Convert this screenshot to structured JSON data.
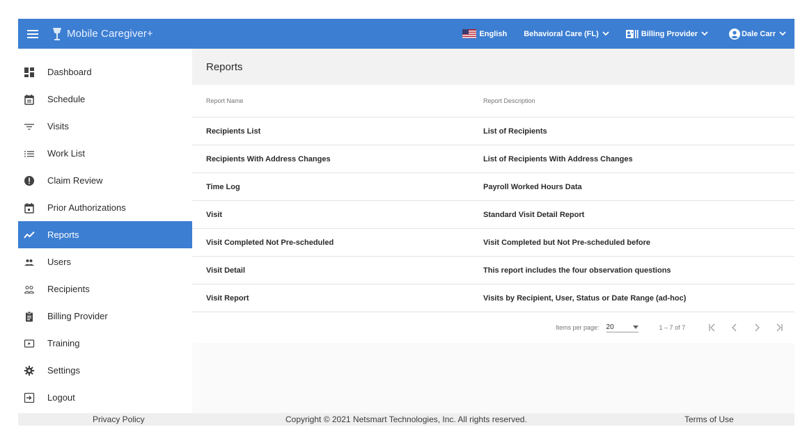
{
  "app": {
    "name": "Mobile Caregiver+",
    "brand_color": "#3c7ed2"
  },
  "topbar": {
    "language": "English",
    "organization": "Behavioral Care (FL)",
    "billing_provider": "Billing Provider",
    "user": "Dale Carr"
  },
  "sidebar": {
    "items": [
      {
        "label": "Dashboard",
        "icon": "dashboard-icon"
      },
      {
        "label": "Schedule",
        "icon": "calendar-icon"
      },
      {
        "label": "Visits",
        "icon": "filter-icon"
      },
      {
        "label": "Work List",
        "icon": "list-icon"
      },
      {
        "label": "Claim Review",
        "icon": "alert-circle-icon"
      },
      {
        "label": "Prior Authorizations",
        "icon": "calendar-event-icon"
      },
      {
        "label": "Reports",
        "icon": "trend-icon",
        "active": true
      },
      {
        "label": "Users",
        "icon": "users-icon"
      },
      {
        "label": "Recipients",
        "icon": "recipients-icon"
      },
      {
        "label": "Billing Provider",
        "icon": "clipboard-icon"
      },
      {
        "label": "Training",
        "icon": "training-icon"
      },
      {
        "label": "Settings",
        "icon": "gear-icon"
      },
      {
        "label": "Logout",
        "icon": "logout-icon"
      }
    ]
  },
  "main": {
    "title": "Reports",
    "columns": [
      "Report Name",
      "Report Description"
    ],
    "rows": [
      {
        "name": "Recipients List",
        "description": "List of Recipients"
      },
      {
        "name": "Recipients With Address Changes",
        "description": "List of Recipients With Address Changes"
      },
      {
        "name": "Time Log",
        "description": "Payroll Worked Hours Data"
      },
      {
        "name": "Visit",
        "description": "Standard Visit Detail Report"
      },
      {
        "name": "Visit Completed Not Pre-scheduled",
        "description": "Visit Completed but Not Pre-scheduled before"
      },
      {
        "name": "Visit Detail",
        "description": "This report includes the four observation questions"
      },
      {
        "name": "Visit Report",
        "description": "Visits by Recipient, User, Status or Date Range (ad-hoc)"
      }
    ],
    "pager": {
      "items_per_page_label": "Items per page:",
      "page_size": "20",
      "range": "1 – 7 of 7"
    }
  },
  "footer": {
    "privacy": "Privacy Policy",
    "copyright": "Copyright © 2021 Netsmart Technologies, Inc. All rights reserved.",
    "terms": "Terms of Use"
  }
}
